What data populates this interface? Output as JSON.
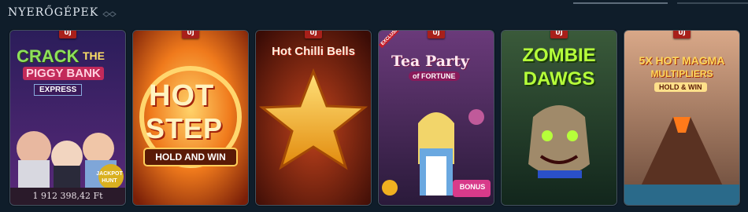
{
  "section": {
    "title": "NYERŐGÉPEK"
  },
  "new_badge": "ÚJ",
  "cards": [
    {
      "title_line1": "CRACK",
      "title_line2": "THE",
      "title_line3": "PIGGY BANK",
      "title_line4": "EXPRESS",
      "corner": "JACKPOT HUNT",
      "amount": "1 912 398,42 Ft"
    },
    {
      "title_line1": "HOT",
      "title_line2": "STEP",
      "subtitle": "HOLD AND WIN"
    },
    {
      "title": "Hot Chilli Bells"
    },
    {
      "ribbon": "EXCLUSIVE",
      "title_line1": "Tea Party",
      "title_line2": "of FORTUNE",
      "bonus": "BONUS"
    },
    {
      "title_line1": "ZOMBIE",
      "title_line2": "DAWGS"
    },
    {
      "title_line1": "5X HOT MAGMA",
      "title_line2": "MULTIPLIERS",
      "subtitle": "HOLD & WIN"
    }
  ]
}
